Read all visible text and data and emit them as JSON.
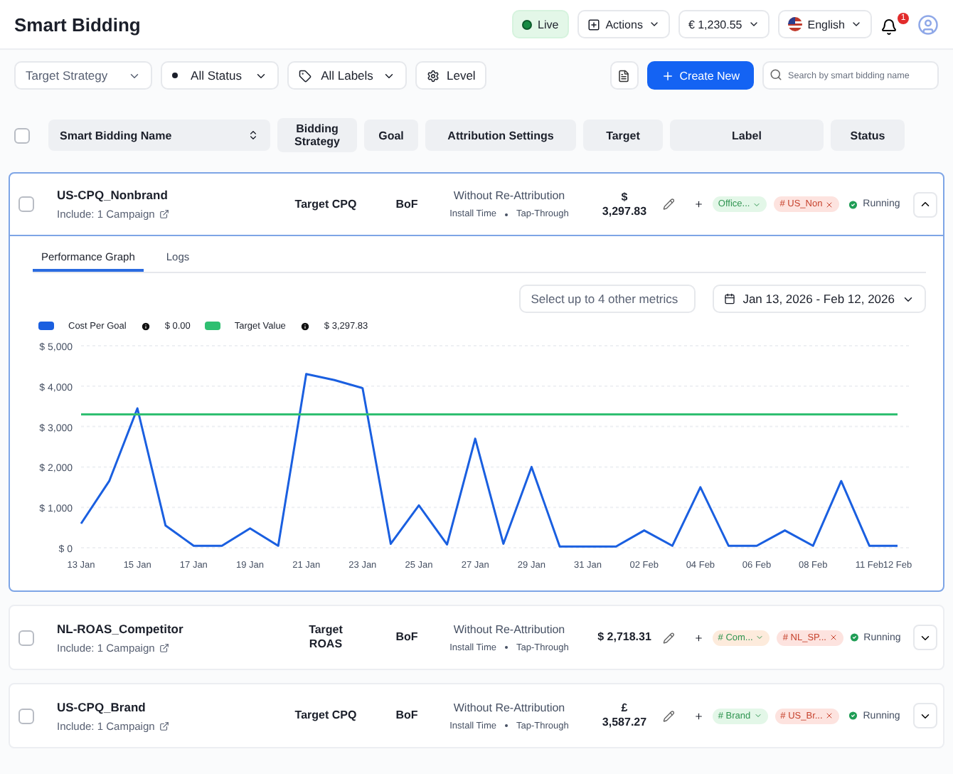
{
  "header": {
    "title": "Smart Bidding",
    "live": {
      "label": "Live",
      "on": true
    },
    "actions": "Actions",
    "balance": "€ 1,230.55",
    "language": "English",
    "notifications": "1"
  },
  "filters": {
    "strategy": "Target Strategy",
    "status": "All Status",
    "labels": "All Labels",
    "level": "Level",
    "create": "Create New",
    "search": {
      "placeholder": "Search by smart bidding name"
    }
  },
  "select_all": {
    "checked": false
  },
  "columns": [
    "Smart Bidding Name",
    "Bidding Strategy",
    "Goal",
    "Attribution Settings",
    "Target",
    "Label",
    "Status"
  ],
  "rows": [
    {
      "name": "US-CPQ_Nonbrand",
      "include": "Include: 1 Campaign",
      "strategy": [
        "Target CPQ"
      ],
      "goal": "BoF",
      "attribution": "Without Re-Attribution",
      "attr_time": "Install Time",
      "attr_type": "Tap-Through",
      "target": [
        "$",
        "3,297.83"
      ],
      "labels": [
        {
          "text": "Office...",
          "color": "#e3f7e8",
          "kind": "select"
        },
        {
          "text": "# US_Non",
          "color": "#fde3df",
          "kind": "tag"
        }
      ],
      "status": "Running",
      "expanded": true,
      "checked": false
    },
    {
      "name": "NL-ROAS_Competitor",
      "include": "Include: 1 Campaign",
      "strategy": [
        "Target",
        "ROAS"
      ],
      "goal": "BoF",
      "attribution": "Without Re-Attribution",
      "attr_time": "Install Time",
      "attr_type": "Tap-Through",
      "target": [
        "$ 2,718.31"
      ],
      "labels": [
        {
          "text": "# Com...",
          "color": "#fdebdc",
          "kind": "select"
        },
        {
          "text": "# NL_SP...",
          "color": "#fde3df",
          "kind": "tag"
        }
      ],
      "status": "Running",
      "expanded": false,
      "checked": false
    },
    {
      "name": "US-CPQ_Brand",
      "include": "Include: 1 Campaign",
      "strategy": [
        "Target CPQ"
      ],
      "goal": "BoF",
      "attribution": "Without Re-Attribution",
      "attr_time": "Install Time",
      "attr_type": "Tap-Through",
      "target": [
        "£",
        "3,587.27"
      ],
      "labels": [
        {
          "text": "# Brand",
          "color": "#e3f7e8",
          "kind": "select"
        },
        {
          "text": "# US_Br...",
          "color": "#fde3df",
          "kind": "tag"
        }
      ],
      "status": "Running",
      "expanded": false,
      "checked": false
    }
  ],
  "detail": {
    "tabs": [
      {
        "label": "Performance Graph",
        "selected": true
      },
      {
        "label": "Logs",
        "selected": false
      }
    ],
    "metrics": "Select up to 4 other metrics",
    "date_range": "Jan 13, 2026 - Feb 12, 2026",
    "legend": [
      {
        "value": "$ 0.00"
      },
      {
        "value": "$ 3,297.83"
      }
    ],
    "chart_data": {
      "type": "line",
      "grid": true,
      "categories": [
        "13 Jan",
        null,
        "15 Jan",
        null,
        "17 Jan",
        null,
        "19 Jan",
        null,
        "21 Jan",
        null,
        "23 Jan",
        null,
        "25 Jan",
        null,
        "27 Jan",
        null,
        "29 Jan",
        null,
        "31 Jan",
        null,
        "02 Feb",
        null,
        "04 Feb",
        null,
        "06 Feb",
        null,
        "08 Feb",
        null,
        "11 Feb",
        "12 Feb"
      ],
      "series": [
        {
          "name": "Cost Per Goal",
          "color": "#1a5fe0",
          "values": [
            600,
            1650,
            3450,
            550,
            50,
            50,
            480,
            50,
            4300,
            4150,
            3950,
            100,
            1050,
            80,
            2700,
            100,
            2000,
            30,
            30,
            30,
            430,
            50,
            1500,
            50,
            50,
            430,
            50,
            1650,
            50,
            50
          ]
        },
        {
          "name": "Target Value",
          "color": "#2fbf71",
          "values": [
            3300,
            3300,
            3300,
            3300,
            3300,
            3300,
            3300,
            3300,
            3300,
            3300,
            3300,
            3300,
            3300,
            3300,
            3300,
            3300,
            3300,
            3300,
            3300,
            3300,
            3300,
            3300,
            3300,
            3300,
            3300,
            3300,
            3300,
            3300,
            3300,
            3300
          ]
        }
      ],
      "ylim": [
        0,
        5000
      ],
      "yticks": [
        {
          "value": 0,
          "label": "$ 0"
        },
        {
          "value": 1000,
          "label": "$ 1,000"
        },
        {
          "value": 2000,
          "label": "$ 2,000"
        },
        {
          "value": 3000,
          "label": "$ 3,000"
        },
        {
          "value": 4000,
          "label": "$ 4,000"
        },
        {
          "value": 5000,
          "label": "$ 5,000"
        }
      ]
    }
  }
}
